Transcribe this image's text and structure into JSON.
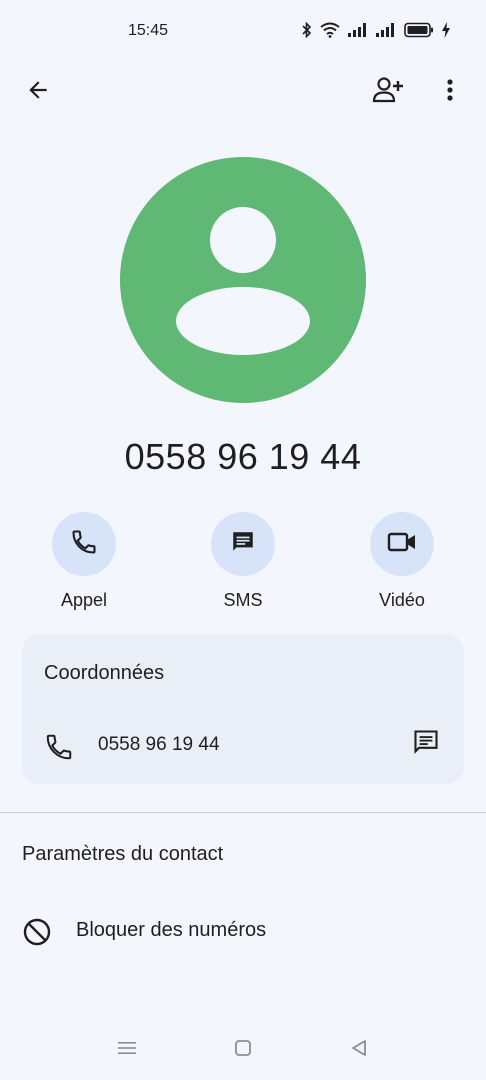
{
  "status_bar": {
    "time": "15:45",
    "icons": [
      "bluetooth-icon",
      "wifi-icon",
      "signal-icon",
      "signal-icon",
      "battery-icon",
      "charging-icon"
    ]
  },
  "top_bar": {
    "icons": [
      "arrow-back-icon",
      "add-person-icon",
      "more-vert-icon"
    ]
  },
  "contact": {
    "number": "0558 96 19 44",
    "avatar_color": "#5fb873"
  },
  "actions": [
    {
      "label": "Appel",
      "icon": "phone-icon"
    },
    {
      "label": "SMS",
      "icon": "message-icon"
    },
    {
      "label": "Vidéo",
      "icon": "videocam-icon"
    }
  ],
  "details_card": {
    "title": "Coordonnées",
    "phone_number": "0558 96 19 44",
    "row_icons": [
      "phone-icon",
      "message-icon"
    ]
  },
  "settings": {
    "title": "Paramètres du contact",
    "block_label": "Bloquer des numéros",
    "block_icon": "block-icon"
  },
  "nav_bar": {
    "icons": [
      "menu-icon",
      "home-icon",
      "back-triangle-icon"
    ]
  },
  "colors": {
    "background": "#f3f6fc",
    "action_circle": "#d7e3f8",
    "card": "#e9eef7",
    "text": "#1f1f1f"
  }
}
